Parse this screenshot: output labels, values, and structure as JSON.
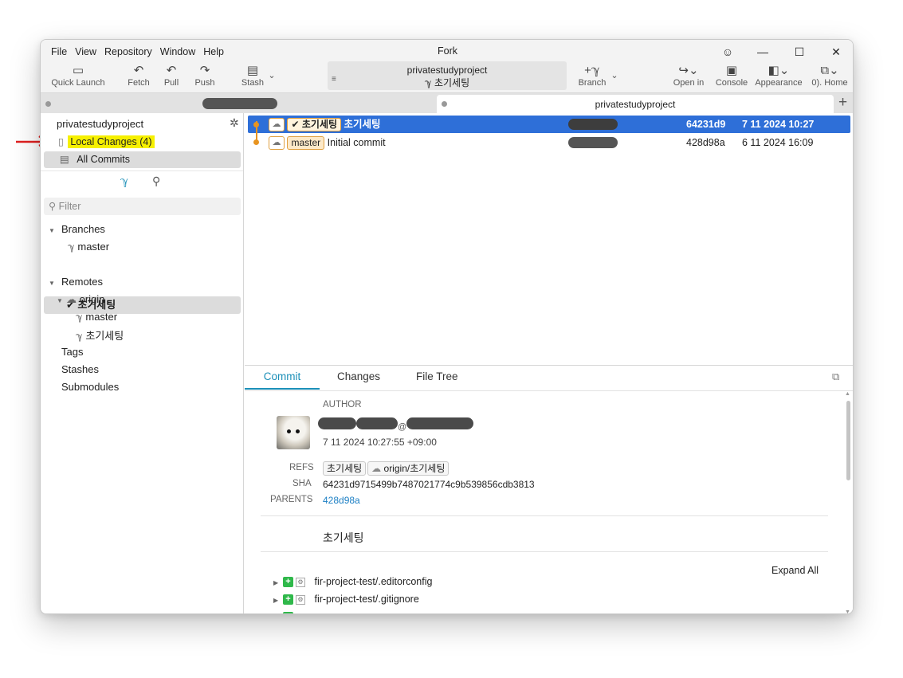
{
  "menu": [
    "File",
    "View",
    "Repository",
    "Window",
    "Help"
  ],
  "app_title": "Fork",
  "toolbar": {
    "quick_launch": "Quick Launch",
    "fetch": "Fetch",
    "pull": "Pull",
    "push": "Push",
    "stash": "Stash",
    "branch": "Branch",
    "open_in": "Open in",
    "console": "Console",
    "appearance": "Appearance",
    "home": "0). Home"
  },
  "repo_box": {
    "name": "privatestudyproject",
    "branch": "초기세팅"
  },
  "tabs": {
    "active": "privatestudyproject"
  },
  "sidebar": {
    "repo_name": "privatestudyproject",
    "local_changes": "Local Changes (4)",
    "all_commits": "All Commits",
    "filter_placeholder": "Filter",
    "branches_label": "Branches",
    "branches": [
      "master",
      "초기세팅"
    ],
    "remotes_label": "Remotes",
    "remote_name": "origin",
    "remote_branches": [
      "master",
      "초기세팅"
    ],
    "tags_label": "Tags",
    "stashes_label": "Stashes",
    "submodules_label": "Submodules"
  },
  "commits": [
    {
      "ref": "초기세팅",
      "message": "초기세팅",
      "sha": "64231d9",
      "date": "7 11 2024 10:27",
      "selected": true
    },
    {
      "ref": "master",
      "message": "Initial commit",
      "sha": "428d98a",
      "date": "6 11 2024 16:09",
      "selected": false
    }
  ],
  "details": {
    "tabs": [
      "Commit",
      "Changes",
      "File Tree"
    ],
    "author_label": "AUTHOR",
    "author_email_at": "@",
    "author_date": "7 11 2024 10:27:55 +09:00",
    "refs_label": "REFS",
    "refs": [
      "초기세팅",
      "origin/초기세팅"
    ],
    "sha_label": "SHA",
    "sha": "64231d9715499b7487021774c9b539856cdb3813",
    "parents_label": "PARENTS",
    "parent": "428d98a",
    "message": "초기세팅",
    "expand_all": "Expand All",
    "files": [
      "fir-project-test/.editorconfig",
      "fir-project-test/.gitignore"
    ]
  },
  "colors": {
    "selection": "#2e6fd8",
    "accent": "#1b8fb8",
    "graph": "#e89420",
    "highlight": "#f6f000",
    "annotation_arrow": "#e02020"
  }
}
